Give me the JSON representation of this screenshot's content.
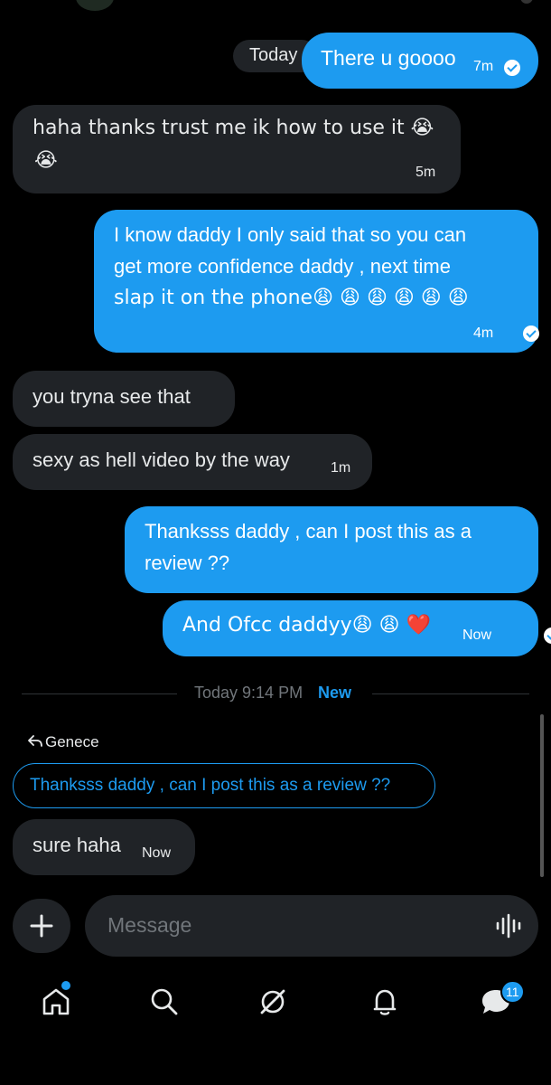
{
  "chat": {
    "today_pill": "Today",
    "messages": [
      {
        "text": "There u goooo",
        "time": "7m"
      },
      {
        "line1": "haha thanks trust me ik how to use it 😭",
        "line2": "😭",
        "time": "5m"
      },
      {
        "line1": "I know daddy I only said that so you can",
        "line2": "get more confidence daddy , next time",
        "line3": "slap it on the phone😩 😩 😩 😩 😩 😩",
        "time": "4m"
      },
      {
        "text": "you tryna see that"
      },
      {
        "text": "sexy as hell video by the way",
        "time": "1m"
      },
      {
        "line1": "Thanksss daddy , can I post this as a",
        "line2": "review ??"
      },
      {
        "text": "And Ofcc daddyy😩 😩 ❤️",
        "time": "Now"
      }
    ],
    "separator": {
      "time": "Today 9:14 PM",
      "new_label": "New"
    },
    "reply": {
      "author": "Genece",
      "quoted": "Thanksss daddy , can I post this as a review ??",
      "text": "sure haha",
      "time": "Now"
    }
  },
  "composer": {
    "placeholder": "Message",
    "plus_icon": "plus-icon",
    "voice_icon": "waveform-icon"
  },
  "bottom_nav": {
    "items": [
      "home-icon",
      "search-icon",
      "grok-icon",
      "bell-icon",
      "messages-icon"
    ],
    "messages_badge": "11"
  },
  "colors": {
    "accent": "#1d9bf0",
    "bubble_in": "#202327",
    "background": "#000000"
  }
}
